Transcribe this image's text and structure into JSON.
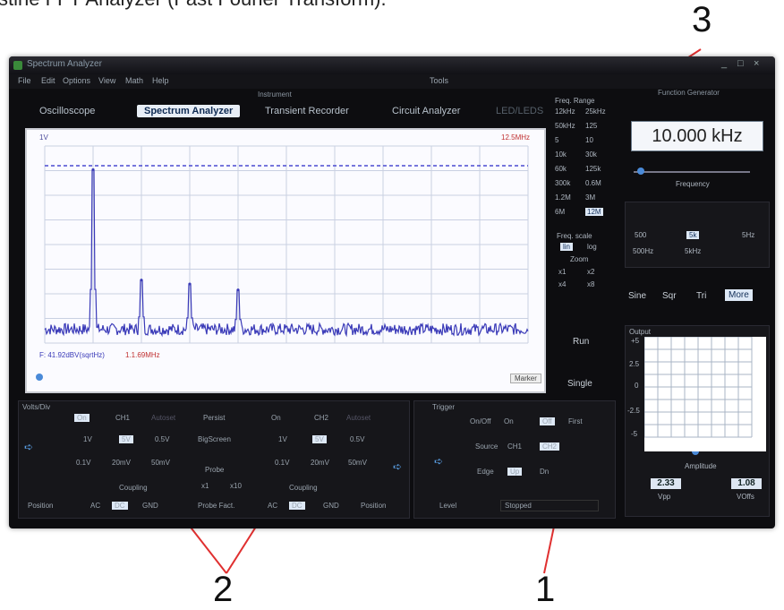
{
  "caption": "stine FFT Analyzer (Fast Fourier Transform).",
  "callouts": [
    "3",
    "2",
    "1"
  ],
  "window": {
    "title": "Spectrum Analyzer",
    "controls": [
      "_",
      "□",
      "×"
    ],
    "menu": [
      "File",
      "Edit",
      "Options",
      "View",
      "Math",
      "Help"
    ],
    "menu_right": "Tools",
    "instruments_label": "Instrument",
    "tabs": [
      "Oscilloscope",
      "Spectrum Analyzer",
      "Transient Recorder",
      "Circuit Analyzer",
      "LED/LEDS"
    ],
    "active_tab": 1,
    "function_generator_label": "Function Generator"
  },
  "scope": {
    "ch_label": "1V",
    "top_right_label": "12.5MHz",
    "readout": "F: 41.92dBV(sqrtHz)",
    "readout_freq": "1.1.69MHz",
    "button": "Marker",
    "chart_data": {
      "type": "line",
      "title": "",
      "xlabel": "",
      "ylabel": "",
      "x_range": [
        0,
        12.5
      ],
      "peaks_x": [
        1.25,
        2.5,
        3.75,
        5.0
      ],
      "peaks_level_frac": [
        0.88,
        0.32,
        0.3,
        0.27
      ],
      "noise_floor_frac": 0.07,
      "grid": true
    }
  },
  "freq_range": {
    "label": "Freq. Range",
    "items": [
      "12kHz",
      "25kHz",
      "50kHz",
      "125",
      "5",
      "10",
      "10k",
      "30k",
      "60k",
      "125k",
      "300k",
      "0.6M",
      "1.2M",
      "3M",
      "6M",
      "12M"
    ],
    "selected": "12M",
    "scale_label": "Freq. scale",
    "scale_opts": [
      "lin",
      "log"
    ],
    "zoom_label": "Zoom",
    "zoom_opts": [
      "x1",
      "x2",
      "x4",
      "x8"
    ]
  },
  "run_controls": {
    "run": "Run",
    "single": "Single"
  },
  "function_gen": {
    "freq_value": "10.000 kHz",
    "slider_label": "Frequency",
    "range_buttons": [
      "500",
      "5k",
      "5k",
      "500Hz",
      "5kHz",
      "5Hz"
    ],
    "waveforms": [
      "Sine",
      "Sqr",
      "Tri",
      "More"
    ],
    "active_waveform": 3,
    "output_label": "Output",
    "ytick": [
      "+5",
      "2.5",
      "0",
      "-2.5",
      "-5"
    ],
    "amplitude_label": "Amplitude",
    "vpp_value": "2.33",
    "vpp_label": "Vpp",
    "offset_value": "1.08",
    "offset_label": "VOffs"
  },
  "vertical": {
    "label": "Volts/Div",
    "ch1": {
      "on": "On",
      "name": "CH1",
      "auto": "Autoset"
    },
    "ch2": {
      "on": "On",
      "name": "CH2",
      "auto": "Autoset"
    },
    "volts1": [
      "1V",
      "5V",
      "0.5V"
    ],
    "volts2": [
      "1V",
      "5V",
      "0.5V"
    ],
    "selected1": "5V",
    "selected2": "5V",
    "mv1": [
      "0.1V",
      "20mV",
      "50mV"
    ],
    "mv2": [
      "0.1V",
      "20mV",
      "50mV"
    ],
    "persist": "Persist",
    "big_screen": "BigScreen",
    "probe": "Probe",
    "probe_opts": [
      "x1",
      "x10"
    ],
    "probe_fact": "Probe Fact.",
    "coupling": "Coupling",
    "coupling_opts": [
      "AC",
      "DC",
      "GND"
    ],
    "position": "Position"
  },
  "trigger": {
    "label": "Trigger",
    "onoff": "On/Off",
    "on": "On",
    "off": "Off",
    "first": "First",
    "source": "Source",
    "src_opts": [
      "CH1",
      "CH2"
    ],
    "edge": "Edge",
    "edge_opts": [
      "Up",
      "Dn"
    ],
    "level": "Level",
    "status": "Stopped"
  },
  "colors": {
    "trace": "#3a3ab8",
    "frame": "#0d0d10",
    "highlight": "#dde8f6",
    "accent": "#4a8ad8",
    "marker": "#c0392b"
  }
}
